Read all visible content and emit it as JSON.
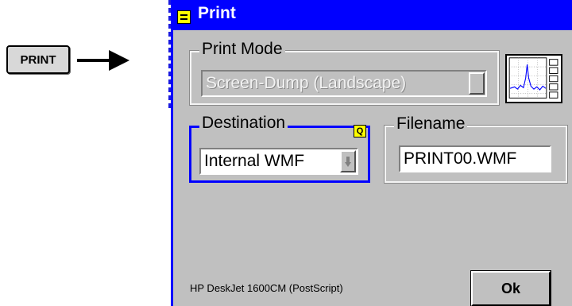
{
  "key": {
    "label": "PRINT"
  },
  "dialog": {
    "title": "Print",
    "print_mode": {
      "label": "Print Mode",
      "selected": "Screen-Dump (Landscape)",
      "enabled": false
    },
    "destination": {
      "label": "Destination",
      "badge": "Q",
      "selected": "Internal WMF"
    },
    "filename": {
      "label": "Filename",
      "value": "PRINT00.WMF"
    },
    "printer_status": "HP DeskJet 1600CM (PostScript)",
    "ok_label": "Ok"
  },
  "colors": {
    "title_bar": "#0000ff",
    "dialog_bg": "#c0c0c0",
    "accent_yellow": "#ffff00",
    "focus_border": "#0000ff"
  },
  "icons": [
    "arrow-right-icon",
    "window-menu-icon",
    "screen-thumbnail-icon",
    "scroll-arrow-icon"
  ]
}
